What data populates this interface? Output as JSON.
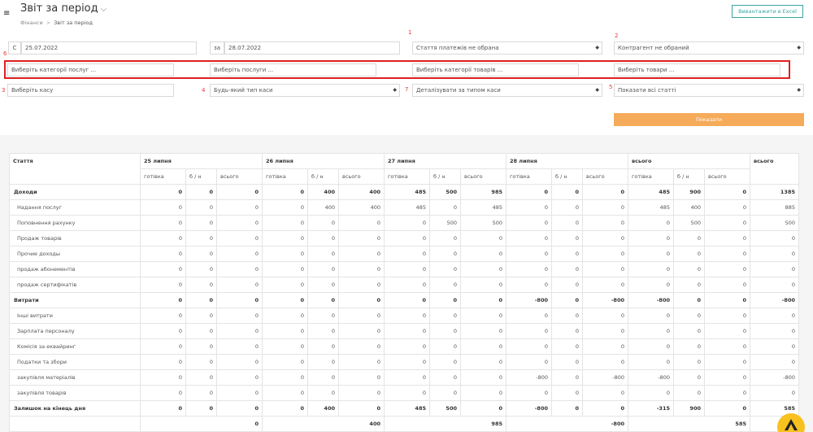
{
  "header": {
    "title": "Звіт за період",
    "breadcrumb": [
      "Фінанси",
      "Звіт за період"
    ],
    "excel_button": "Вивантажити в Excel"
  },
  "filters": {
    "from_prefix": "С",
    "from_date": "25.07.2022",
    "to_prefix": "за",
    "to_date": "28.07.2022",
    "payment_item": "Стаття платежів не обрана",
    "counterparty": "Контрагент не обраний",
    "service_categories": "Виберіть категорії послуг ...",
    "services": "Виберіть послуги ...",
    "product_categories": "Виберіть категорії товарів ...",
    "products": "Виберіть товари ...",
    "cashbox": "Виберіть касу",
    "cashbox_type": "Будь-який тип каси",
    "detail_by": "Деталізувати за типом каси",
    "show_items": "Показати всі статті",
    "show_button": "Показати",
    "markers": [
      "1",
      "2",
      "3",
      "4",
      "5",
      "6",
      "7"
    ]
  },
  "table": {
    "col_article": "Стаття",
    "groups": [
      "25 липня",
      "26 липня",
      "27 липня",
      "28 липня",
      "всього"
    ],
    "total_header": "всього",
    "sub": [
      "готівка",
      "б / н",
      "всього"
    ],
    "rows": [
      {
        "label": "Доходи",
        "bold": true,
        "v": [
          "0",
          "0",
          "0",
          "0",
          "400",
          "400",
          "485",
          "500",
          "985",
          "0",
          "0",
          "0",
          "485",
          "900",
          "0",
          "1385"
        ]
      },
      {
        "label": "Надання послуг",
        "bold": false,
        "v": [
          "0",
          "0",
          "0",
          "0",
          "400",
          "400",
          "485",
          "0",
          "485",
          "0",
          "0",
          "0",
          "485",
          "400",
          "0",
          "885"
        ]
      },
      {
        "label": "Поповнення рахунку",
        "bold": false,
        "v": [
          "0",
          "0",
          "0",
          "0",
          "0",
          "0",
          "0",
          "500",
          "500",
          "0",
          "0",
          "0",
          "0",
          "500",
          "0",
          "500"
        ]
      },
      {
        "label": "Продаж товарів",
        "bold": false,
        "v": [
          "0",
          "0",
          "0",
          "0",
          "0",
          "0",
          "0",
          "0",
          "0",
          "0",
          "0",
          "0",
          "0",
          "0",
          "0",
          "0"
        ]
      },
      {
        "label": "Прочие доходы",
        "bold": false,
        "v": [
          "0",
          "0",
          "0",
          "0",
          "0",
          "0",
          "0",
          "0",
          "0",
          "0",
          "0",
          "0",
          "0",
          "0",
          "0",
          "0"
        ]
      },
      {
        "label": "продаж абонементів",
        "bold": false,
        "v": [
          "0",
          "0",
          "0",
          "0",
          "0",
          "0",
          "0",
          "0",
          "0",
          "0",
          "0",
          "0",
          "0",
          "0",
          "0",
          "0"
        ]
      },
      {
        "label": "продаж сертифікатів",
        "bold": false,
        "v": [
          "0",
          "0",
          "0",
          "0",
          "0",
          "0",
          "0",
          "0",
          "0",
          "0",
          "0",
          "0",
          "0",
          "0",
          "0",
          "0"
        ]
      },
      {
        "label": "Витрати",
        "bold": true,
        "v": [
          "0",
          "0",
          "0",
          "0",
          "0",
          "0",
          "0",
          "0",
          "0",
          "-800",
          "0",
          "-800",
          "-800",
          "0",
          "0",
          "-800"
        ]
      },
      {
        "label": "Інші витрати",
        "bold": false,
        "v": [
          "0",
          "0",
          "0",
          "0",
          "0",
          "0",
          "0",
          "0",
          "0",
          "0",
          "0",
          "0",
          "0",
          "0",
          "0",
          "0"
        ]
      },
      {
        "label": "Зарплата персоналу",
        "bold": false,
        "v": [
          "0",
          "0",
          "0",
          "0",
          "0",
          "0",
          "0",
          "0",
          "0",
          "0",
          "0",
          "0",
          "0",
          "0",
          "0",
          "0"
        ]
      },
      {
        "label": "Комісія за еквайринг",
        "bold": false,
        "v": [
          "0",
          "0",
          "0",
          "0",
          "0",
          "0",
          "0",
          "0",
          "0",
          "0",
          "0",
          "0",
          "0",
          "0",
          "0",
          "0"
        ]
      },
      {
        "label": "Податки та збори",
        "bold": false,
        "v": [
          "0",
          "0",
          "0",
          "0",
          "0",
          "0",
          "0",
          "0",
          "0",
          "0",
          "0",
          "0",
          "0",
          "0",
          "0",
          "0"
        ]
      },
      {
        "label": "закупівля матеріалів",
        "bold": false,
        "v": [
          "0",
          "0",
          "0",
          "0",
          "0",
          "0",
          "0",
          "0",
          "0",
          "-800",
          "0",
          "-800",
          "-800",
          "0",
          "0",
          "-800"
        ]
      },
      {
        "label": "закупівля товарів",
        "bold": false,
        "v": [
          "0",
          "0",
          "0",
          "0",
          "0",
          "0",
          "0",
          "0",
          "0",
          "0",
          "0",
          "0",
          "0",
          "0",
          "0",
          "0"
        ]
      },
      {
        "label": "Залишок на кінець дня",
        "bold": true,
        "v": [
          "0",
          "0",
          "0",
          "0",
          "400",
          "0",
          "485",
          "500",
          "0",
          "-800",
          "0",
          "0",
          "-315",
          "900",
          "0",
          "585"
        ]
      }
    ],
    "footer": [
      "0",
      "400",
      "985",
      "-800",
      "585"
    ]
  },
  "colors": {
    "accent": "#f5ab5a",
    "excel": "#3aa6a6",
    "highlight": "#e02020"
  },
  "icons": [
    "menu-icon",
    "chevron-down-icon",
    "select-arrow-icon",
    "logo-icon"
  ]
}
